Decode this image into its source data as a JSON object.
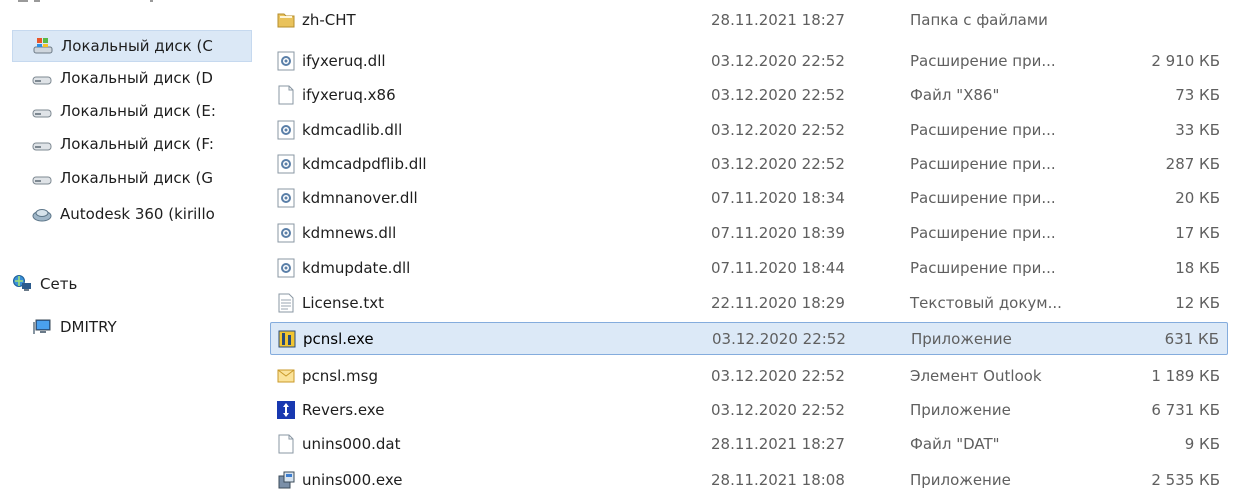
{
  "nav": {
    "items": [
      {
        "label": "Локальный диск (C",
        "icon": "system-drive-icon",
        "selected": true
      },
      {
        "label": "Локальный диск (D",
        "icon": "drive-icon"
      },
      {
        "label": "Локальный диск (E:",
        "icon": "drive-icon"
      },
      {
        "label": "Локальный диск (F:",
        "icon": "drive-icon"
      },
      {
        "label": "Локальный диск (G",
        "icon": "drive-icon"
      },
      {
        "label": "Autodesk 360 (kirillo",
        "icon": "cloud-drive-icon"
      }
    ],
    "network": {
      "label": "Сеть",
      "icon": "network-icon"
    },
    "computer": {
      "label": "DMITRY",
      "icon": "computer-icon"
    }
  },
  "files": [
    {
      "name": "zh-CHT",
      "date": "28.11.2021 18:27",
      "type": "Папка с файлами",
      "size": "",
      "icon": "folder-icon"
    },
    {
      "name": "ifyxeruq.dll",
      "date": "03.12.2020 22:52",
      "type": "Расширение при...",
      "size": "2 910 КБ",
      "icon": "dll-icon"
    },
    {
      "name": "ifyxeruq.x86",
      "date": "03.12.2020 22:52",
      "type": "Файл \"X86\"",
      "size": "73 КБ",
      "icon": "file-icon"
    },
    {
      "name": "kdmcadlib.dll",
      "date": "03.12.2020 22:52",
      "type": "Расширение при...",
      "size": "33 КБ",
      "icon": "dll-icon"
    },
    {
      "name": "kdmcadpdflib.dll",
      "date": "03.12.2020 22:52",
      "type": "Расширение при...",
      "size": "287 КБ",
      "icon": "dll-icon"
    },
    {
      "name": "kdmnanover.dll",
      "date": "07.11.2020 18:34",
      "type": "Расширение при...",
      "size": "20 КБ",
      "icon": "dll-icon"
    },
    {
      "name": "kdmnews.dll",
      "date": "07.11.2020 18:39",
      "type": "Расширение при...",
      "size": "17 КБ",
      "icon": "dll-icon"
    },
    {
      "name": "kdmupdate.dll",
      "date": "07.11.2020 18:44",
      "type": "Расширение при...",
      "size": "18 КБ",
      "icon": "dll-icon"
    },
    {
      "name": "License.txt",
      "date": "22.11.2020 18:29",
      "type": "Текстовый докум...",
      "size": "12 КБ",
      "icon": "text-file-icon"
    },
    {
      "name": "pcnsl.exe",
      "date": "03.12.2020 22:52",
      "type": "Приложение",
      "size": "631 КБ",
      "icon": "app-exe-icon",
      "selected": true
    },
    {
      "name": "pcnsl.msg",
      "date": "03.12.2020 22:52",
      "type": "Элемент Outlook",
      "size": "1 189 КБ",
      "icon": "mail-icon"
    },
    {
      "name": "Revers.exe",
      "date": "03.12.2020 22:52",
      "type": "Приложение",
      "size": "6 731 КБ",
      "icon": "revers-app-icon"
    },
    {
      "name": "unins000.dat",
      "date": "28.11.2021 18:27",
      "type": "Файл \"DAT\"",
      "size": "9 КБ",
      "icon": "file-icon"
    },
    {
      "name": "unins000.exe",
      "date": "28.11.2021 18:08",
      "type": "Приложение",
      "size": "2 535 КБ",
      "icon": "installer-icon"
    }
  ]
}
